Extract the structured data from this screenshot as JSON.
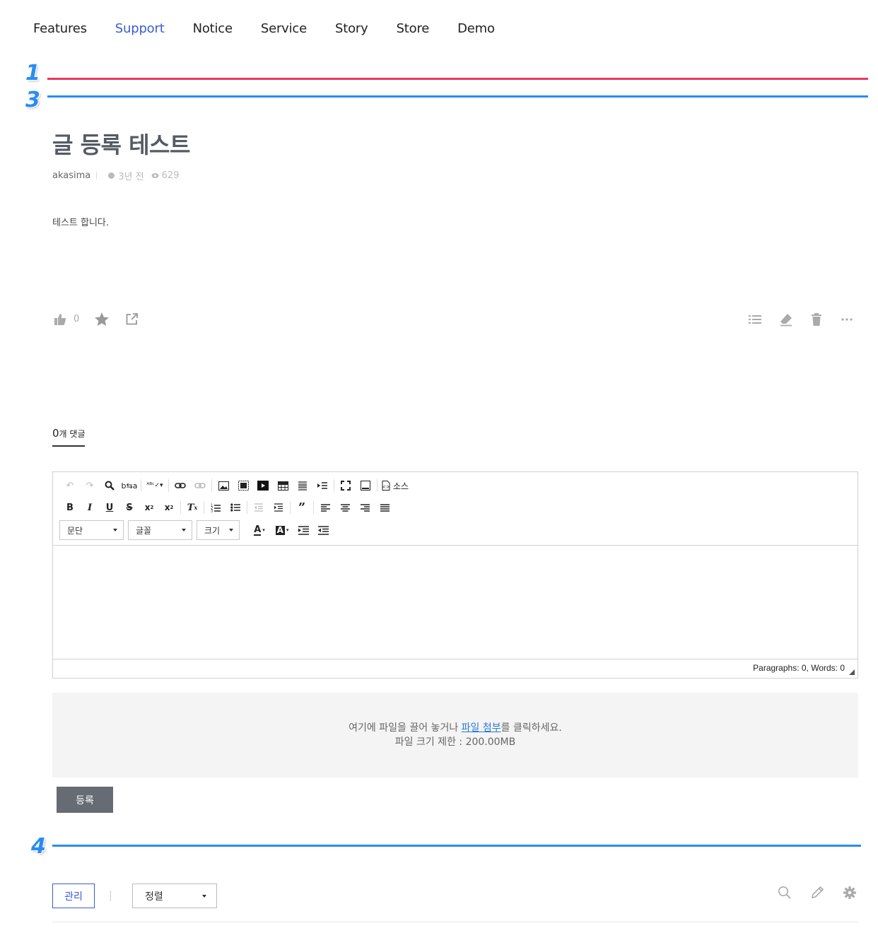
{
  "nav": {
    "items": [
      {
        "label": "Features",
        "active": false
      },
      {
        "label": "Support",
        "active": true
      },
      {
        "label": "Notice",
        "active": false
      },
      {
        "label": "Service",
        "active": false
      },
      {
        "label": "Story",
        "active": false
      },
      {
        "label": "Store",
        "active": false
      },
      {
        "label": "Demo",
        "active": false
      }
    ],
    "active_color": "#3a5bd6"
  },
  "annotations": {
    "marker_1": "1",
    "marker_3": "3",
    "marker_4": "4",
    "colors": {
      "line_1": "#e8375f",
      "line_3": "#2a8cf0",
      "line_4": "#2a8cf0"
    }
  },
  "post": {
    "title": "글 등록 테스트",
    "author": "akasima",
    "time": "3년 전",
    "views": "629",
    "body": "테스트 합니다.",
    "like_count": "0"
  },
  "comments": {
    "count_number": "0",
    "count_suffix": "개 댓글",
    "editor": {
      "source_label": "소스",
      "combo_paragraph": "문단",
      "combo_font": "글꼴",
      "combo_size": "크기",
      "status": "Paragraphs: 0, Words: 0"
    },
    "dropzone": {
      "text_before": "여기에 파일을 끌어 놓거나 ",
      "link": "파일 첨부",
      "text_after": "를 클릭하세요.",
      "limit": "파일 크기 제한 : 200.00MB"
    },
    "submit_label": "등록"
  },
  "list_controls": {
    "manage_label": "관리",
    "sort_label": "정렬"
  },
  "icons": {
    "like": "thumbs-up-icon",
    "favorite": "star-icon",
    "share": "external-link-icon",
    "list": "list-icon",
    "edit": "eraser-icon",
    "delete": "trash-icon",
    "more": "more-icon",
    "search": "search-icon",
    "write": "pencil-icon",
    "settings": "gear-icon"
  }
}
